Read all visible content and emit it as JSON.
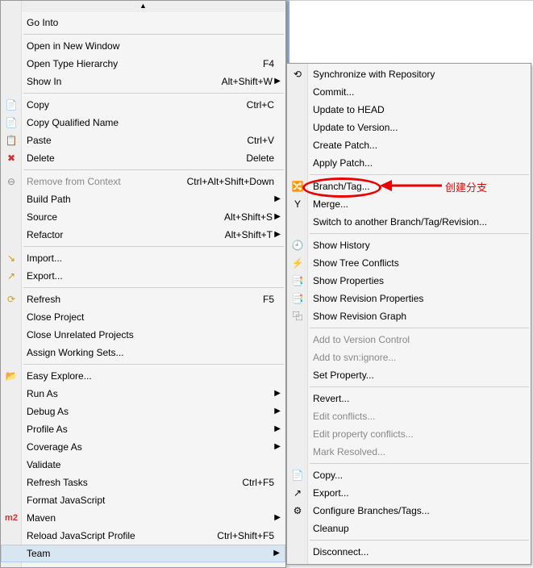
{
  "annotation": {
    "text": "创建分支"
  },
  "left_menu": {
    "scroll_top": "▲",
    "items": [
      {
        "label": "Go Into",
        "t": "item"
      },
      {
        "t": "sep"
      },
      {
        "label": "Open in New Window",
        "t": "item"
      },
      {
        "label": "Open Type Hierarchy",
        "accel": "F4",
        "t": "item"
      },
      {
        "label": "Show In",
        "accel": "Alt+Shift+W",
        "submenu": true,
        "t": "item"
      },
      {
        "t": "sep"
      },
      {
        "label": "Copy",
        "accel": "Ctrl+C",
        "icon": "📄",
        "iconColor": "#3b7dbf",
        "t": "item"
      },
      {
        "label": "Copy Qualified Name",
        "icon": "📄",
        "iconColor": "#3b7dbf",
        "t": "item"
      },
      {
        "label": "Paste",
        "accel": "Ctrl+V",
        "icon": "📋",
        "iconColor": "#3b7dbf",
        "t": "item"
      },
      {
        "label": "Delete",
        "accel": "Delete",
        "icon": "✖",
        "iconColor": "#c33",
        "t": "item"
      },
      {
        "t": "sep"
      },
      {
        "label": "Remove from Context",
        "accel": "Ctrl+Alt+Shift+Down",
        "icon": "⊖",
        "disabled": true,
        "t": "item"
      },
      {
        "label": "Build Path",
        "submenu": true,
        "t": "item"
      },
      {
        "label": "Source",
        "accel": "Alt+Shift+S",
        "submenu": true,
        "t": "item"
      },
      {
        "label": "Refactor",
        "accel": "Alt+Shift+T",
        "submenu": true,
        "t": "item"
      },
      {
        "t": "sep"
      },
      {
        "label": "Import...",
        "icon": "↘",
        "iconColor": "#c90",
        "t": "item"
      },
      {
        "label": "Export...",
        "icon": "↗",
        "iconColor": "#c90",
        "t": "item"
      },
      {
        "t": "sep"
      },
      {
        "label": "Refresh",
        "accel": "F5",
        "icon": "⟳",
        "iconColor": "#d4a017",
        "t": "item"
      },
      {
        "label": "Close Project",
        "t": "item"
      },
      {
        "label": "Close Unrelated Projects",
        "t": "item"
      },
      {
        "label": "Assign Working Sets...",
        "t": "item"
      },
      {
        "t": "sep"
      },
      {
        "label": "Easy Explore...",
        "icon": "📂",
        "iconColor": "#d4a017",
        "t": "item"
      },
      {
        "label": "Run As",
        "submenu": true,
        "t": "item"
      },
      {
        "label": "Debug As",
        "submenu": true,
        "t": "item"
      },
      {
        "label": "Profile As",
        "submenu": true,
        "t": "item"
      },
      {
        "label": "Coverage As",
        "submenu": true,
        "t": "item"
      },
      {
        "label": "Validate",
        "t": "item"
      },
      {
        "label": "Refresh Tasks",
        "accel": "Ctrl+F5",
        "t": "item"
      },
      {
        "label": "Format JavaScript",
        "t": "item"
      },
      {
        "label": "Maven",
        "icon": "m2",
        "iconColor": "#c33",
        "submenu": true,
        "t": "item"
      },
      {
        "label": "Reload JavaScript Profile",
        "accel": "Ctrl+Shift+F5",
        "t": "item"
      },
      {
        "label": "Team",
        "submenu": true,
        "highlight": true,
        "t": "item"
      }
    ]
  },
  "right_menu": {
    "items": [
      {
        "label": "Synchronize with Repository",
        "icon": "⟲",
        "t": "item"
      },
      {
        "label": "Commit...",
        "t": "item"
      },
      {
        "label": "Update to HEAD",
        "t": "item"
      },
      {
        "label": "Update to Version...",
        "t": "item"
      },
      {
        "label": "Create Patch...",
        "t": "item"
      },
      {
        "label": "Apply Patch...",
        "t": "item"
      },
      {
        "t": "sep"
      },
      {
        "label": "Branch/Tag...",
        "icon": "🔀",
        "annotated": true,
        "t": "item"
      },
      {
        "label": "Merge...",
        "icon": "Y",
        "t": "item"
      },
      {
        "label": "Switch to another Branch/Tag/Revision...",
        "t": "item"
      },
      {
        "t": "sep"
      },
      {
        "label": "Show History",
        "icon": "🕘",
        "t": "item"
      },
      {
        "label": "Show Tree Conflicts",
        "icon": "⚡",
        "t": "item"
      },
      {
        "label": "Show Properties",
        "icon": "📑",
        "t": "item"
      },
      {
        "label": "Show Revision Properties",
        "icon": "📑",
        "t": "item"
      },
      {
        "label": "Show Revision Graph",
        "icon": "⿻",
        "t": "item"
      },
      {
        "t": "sep"
      },
      {
        "label": "Add to Version Control",
        "disabled": true,
        "t": "item"
      },
      {
        "label": "Add to svn:ignore...",
        "disabled": true,
        "t": "item"
      },
      {
        "label": "Set Property...",
        "t": "item"
      },
      {
        "t": "sep"
      },
      {
        "label": "Revert...",
        "t": "item"
      },
      {
        "label": "Edit conflicts...",
        "disabled": true,
        "t": "item"
      },
      {
        "label": "Edit property conflicts...",
        "disabled": true,
        "t": "item"
      },
      {
        "label": "Mark Resolved...",
        "disabled": true,
        "t": "item"
      },
      {
        "t": "sep"
      },
      {
        "label": "Copy...",
        "icon": "📄",
        "t": "item"
      },
      {
        "label": "Export...",
        "icon": "↗",
        "t": "item"
      },
      {
        "label": "Configure Branches/Tags...",
        "icon": "⚙",
        "t": "item"
      },
      {
        "label": "Cleanup",
        "t": "item"
      },
      {
        "t": "sep"
      },
      {
        "label": "Disconnect...",
        "t": "item"
      }
    ]
  }
}
